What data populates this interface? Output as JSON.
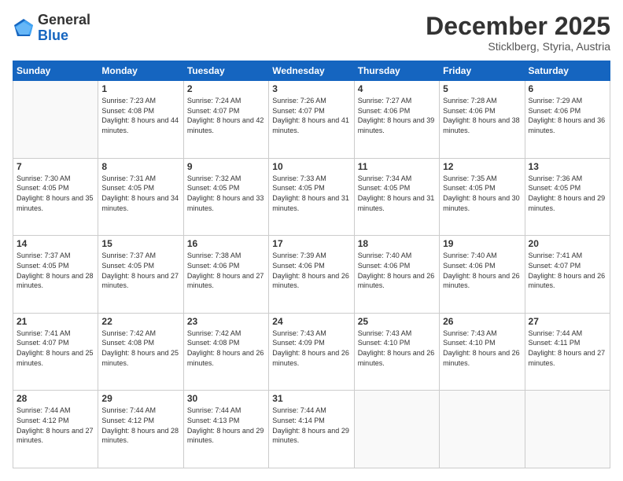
{
  "header": {
    "logo_general": "General",
    "logo_blue": "Blue",
    "month": "December 2025",
    "location": "Sticklberg, Styria, Austria"
  },
  "weekdays": [
    "Sunday",
    "Monday",
    "Tuesday",
    "Wednesday",
    "Thursday",
    "Friday",
    "Saturday"
  ],
  "weeks": [
    [
      {
        "day": "",
        "empty": true
      },
      {
        "day": "1",
        "sunrise": "7:23 AM",
        "sunset": "4:08 PM",
        "daylight": "8 hours and 44 minutes."
      },
      {
        "day": "2",
        "sunrise": "7:24 AM",
        "sunset": "4:07 PM",
        "daylight": "8 hours and 42 minutes."
      },
      {
        "day": "3",
        "sunrise": "7:26 AM",
        "sunset": "4:07 PM",
        "daylight": "8 hours and 41 minutes."
      },
      {
        "day": "4",
        "sunrise": "7:27 AM",
        "sunset": "4:06 PM",
        "daylight": "8 hours and 39 minutes."
      },
      {
        "day": "5",
        "sunrise": "7:28 AM",
        "sunset": "4:06 PM",
        "daylight": "8 hours and 38 minutes."
      },
      {
        "day": "6",
        "sunrise": "7:29 AM",
        "sunset": "4:06 PM",
        "daylight": "8 hours and 36 minutes."
      }
    ],
    [
      {
        "day": "7",
        "sunrise": "7:30 AM",
        "sunset": "4:05 PM",
        "daylight": "8 hours and 35 minutes."
      },
      {
        "day": "8",
        "sunrise": "7:31 AM",
        "sunset": "4:05 PM",
        "daylight": "8 hours and 34 minutes."
      },
      {
        "day": "9",
        "sunrise": "7:32 AM",
        "sunset": "4:05 PM",
        "daylight": "8 hours and 33 minutes."
      },
      {
        "day": "10",
        "sunrise": "7:33 AM",
        "sunset": "4:05 PM",
        "daylight": "8 hours and 31 minutes."
      },
      {
        "day": "11",
        "sunrise": "7:34 AM",
        "sunset": "4:05 PM",
        "daylight": "8 hours and 31 minutes."
      },
      {
        "day": "12",
        "sunrise": "7:35 AM",
        "sunset": "4:05 PM",
        "daylight": "8 hours and 30 minutes."
      },
      {
        "day": "13",
        "sunrise": "7:36 AM",
        "sunset": "4:05 PM",
        "daylight": "8 hours and 29 minutes."
      }
    ],
    [
      {
        "day": "14",
        "sunrise": "7:37 AM",
        "sunset": "4:05 PM",
        "daylight": "8 hours and 28 minutes."
      },
      {
        "day": "15",
        "sunrise": "7:37 AM",
        "sunset": "4:05 PM",
        "daylight": "8 hours and 27 minutes."
      },
      {
        "day": "16",
        "sunrise": "7:38 AM",
        "sunset": "4:06 PM",
        "daylight": "8 hours and 27 minutes."
      },
      {
        "day": "17",
        "sunrise": "7:39 AM",
        "sunset": "4:06 PM",
        "daylight": "8 hours and 26 minutes."
      },
      {
        "day": "18",
        "sunrise": "7:40 AM",
        "sunset": "4:06 PM",
        "daylight": "8 hours and 26 minutes."
      },
      {
        "day": "19",
        "sunrise": "7:40 AM",
        "sunset": "4:06 PM",
        "daylight": "8 hours and 26 minutes."
      },
      {
        "day": "20",
        "sunrise": "7:41 AM",
        "sunset": "4:07 PM",
        "daylight": "8 hours and 26 minutes."
      }
    ],
    [
      {
        "day": "21",
        "sunrise": "7:41 AM",
        "sunset": "4:07 PM",
        "daylight": "8 hours and 25 minutes."
      },
      {
        "day": "22",
        "sunrise": "7:42 AM",
        "sunset": "4:08 PM",
        "daylight": "8 hours and 25 minutes."
      },
      {
        "day": "23",
        "sunrise": "7:42 AM",
        "sunset": "4:08 PM",
        "daylight": "8 hours and 26 minutes."
      },
      {
        "day": "24",
        "sunrise": "7:43 AM",
        "sunset": "4:09 PM",
        "daylight": "8 hours and 26 minutes."
      },
      {
        "day": "25",
        "sunrise": "7:43 AM",
        "sunset": "4:10 PM",
        "daylight": "8 hours and 26 minutes."
      },
      {
        "day": "26",
        "sunrise": "7:43 AM",
        "sunset": "4:10 PM",
        "daylight": "8 hours and 26 minutes."
      },
      {
        "day": "27",
        "sunrise": "7:44 AM",
        "sunset": "4:11 PM",
        "daylight": "8 hours and 27 minutes."
      }
    ],
    [
      {
        "day": "28",
        "sunrise": "7:44 AM",
        "sunset": "4:12 PM",
        "daylight": "8 hours and 27 minutes."
      },
      {
        "day": "29",
        "sunrise": "7:44 AM",
        "sunset": "4:12 PM",
        "daylight": "8 hours and 28 minutes."
      },
      {
        "day": "30",
        "sunrise": "7:44 AM",
        "sunset": "4:13 PM",
        "daylight": "8 hours and 29 minutes."
      },
      {
        "day": "31",
        "sunrise": "7:44 AM",
        "sunset": "4:14 PM",
        "daylight": "8 hours and 29 minutes."
      },
      {
        "day": "",
        "empty": true
      },
      {
        "day": "",
        "empty": true
      },
      {
        "day": "",
        "empty": true
      }
    ]
  ]
}
